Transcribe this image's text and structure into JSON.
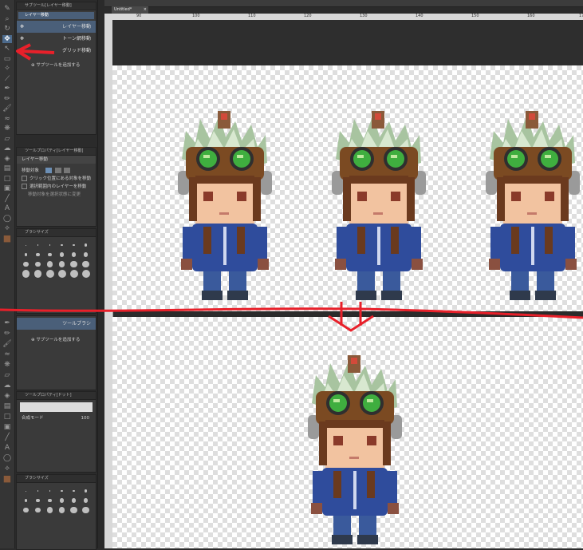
{
  "document_tab": {
    "label": "Untitled*"
  },
  "ruler": {
    "ticks": [
      "90",
      "100",
      "110",
      "120",
      "130",
      "140",
      "150",
      "160",
      "170"
    ]
  },
  "subtool_panel_top": {
    "title": "サブツール[レイヤー移動]",
    "group_label": "レイヤー移動",
    "items": [
      "レイヤー移動",
      "トーン網移動",
      "グリッド移動"
    ],
    "add_label": "サブツールを追加する"
  },
  "tool_property_top": {
    "title": "ツールプロパティ[レイヤー移動]",
    "tool_name": "レイヤー移動",
    "target_label": "移動対象",
    "option1": "クリック位置にある対象を移動",
    "option2": "選択範囲内のレイヤーを移動",
    "option3": "移動対象を選択状態に変更"
  },
  "brush_size_top": {
    "title": "ブラシサイズ",
    "sizes": [
      "0.7",
      "1",
      "1.5",
      "2",
      "2.5",
      "3",
      "4",
      "5",
      "6",
      "7",
      "8",
      "10",
      "12",
      "15",
      "17",
      "20",
      "25",
      "30",
      "40",
      "50",
      "60",
      "70",
      "80",
      "100"
    ]
  },
  "subtool_panel_bottom": {
    "item": "ツールブラシ",
    "add_label": "サブツールを追加する"
  },
  "tool_property_bottom": {
    "title": "ツールプロパティ[ドット]",
    "blend_label": "合成モード",
    "value": "100"
  },
  "brush_size_bottom": {
    "title": "ブラシサイズ",
    "sizes": [
      "1",
      "2",
      "3",
      "4",
      "5",
      "6",
      "7",
      "8",
      "10",
      "12",
      "15",
      "17",
      "20",
      "25",
      "30",
      "40",
      "50",
      "60"
    ]
  },
  "colors": {
    "red_annotation": "#e8202a",
    "selection_blue": "#4a5f79",
    "main_color": "#8a5a3a"
  },
  "toolbar_icons": [
    "pen-icon",
    "zoom-icon",
    "rotate-icon",
    "move-icon",
    "operation-icon",
    "select-icon",
    "auto-select-icon",
    "eyedropper-icon",
    "pen-tool-icon",
    "pencil-icon",
    "brush-icon",
    "airbrush-icon",
    "decoration-icon",
    "eraser-icon",
    "blend-icon",
    "fill-icon",
    "gradient-icon",
    "figure-icon",
    "frame-icon",
    "ruler-icon",
    "text-icon",
    "balloon-icon",
    "line-correction-icon",
    "main-color-icon"
  ]
}
